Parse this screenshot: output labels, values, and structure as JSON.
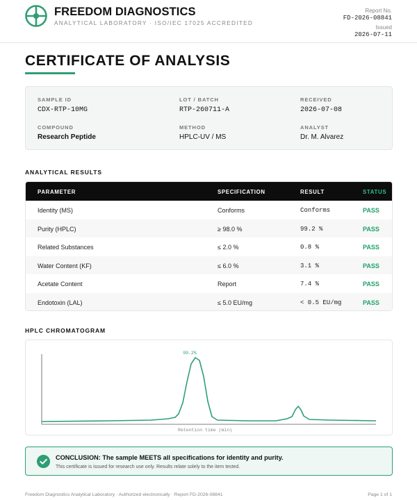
{
  "header": {
    "brand": "FREEDOM DIAGNOSTICS",
    "subtitle": "ANALYTICAL LABORATORY · ISO/IEC 17025 ACCREDITED",
    "report_label": "Report No.",
    "report_no": "FD-2026-08841",
    "issued_label": "Issued",
    "issued_date": "2026-07-11"
  },
  "title": "CERTIFICATE OF ANALYSIS",
  "meta": {
    "sample_id_label": "SAMPLE ID",
    "sample_id": "CDX-RTP-10MG",
    "lot_label": "LOT / BATCH",
    "lot": "RTP-260711-A",
    "received_label": "RECEIVED",
    "received": "2026-07-08",
    "compound_label": "COMPOUND",
    "compound": "Research Peptide",
    "method_label": "METHOD",
    "method": "HPLC-UV / MS",
    "analyst_label": "ANALYST",
    "analyst": "Dr. M. Alvarez"
  },
  "results": {
    "section_title": "ANALYTICAL RESULTS",
    "headers": [
      "PARAMETER",
      "SPECIFICATION",
      "RESULT",
      "STATUS"
    ],
    "rows": [
      {
        "parameter": "Identity (MS)",
        "spec": "Conforms",
        "result": "Conforms",
        "status": "PASS"
      },
      {
        "parameter": "Purity (HPLC)",
        "spec": "≥ 98.0 %",
        "result": "99.2 %",
        "status": "PASS"
      },
      {
        "parameter": "Related Substances",
        "spec": "≤ 2.0 %",
        "result": "0.8 %",
        "status": "PASS"
      },
      {
        "parameter": "Water Content (KF)",
        "spec": "≤ 6.0 %",
        "result": "3.1 %",
        "status": "PASS"
      },
      {
        "parameter": "Acetate Content",
        "spec": "Report",
        "result": "7.4 %",
        "status": "PASS"
      },
      {
        "parameter": "Endotoxin (LAL)",
        "spec": "≤ 5.0 EU/mg",
        "result": "< 0.5 EU/mg",
        "status": "PASS"
      }
    ]
  },
  "chromatogram": {
    "section_title": "HPLC CHROMATOGRAM",
    "peak_label": "99.2%",
    "xlabel": "Retention time (min)",
    "line_color": "#2f9e74"
  },
  "conclusion": {
    "title": "CONCLUSION: The sample MEETS all specifications for identity and purity.",
    "note": "This certificate is issued for research use only. Results relate solely to the item tested."
  },
  "footer": {
    "left": "Freedom Diagnostics Analytical Laboratory · Authorized electronically · Report FD-2026-08841",
    "right": "Page 1 of 1"
  },
  "colors": {
    "accent": "#2f9e74",
    "pass": "#22a06b",
    "table_header": "#0d0d0d"
  }
}
